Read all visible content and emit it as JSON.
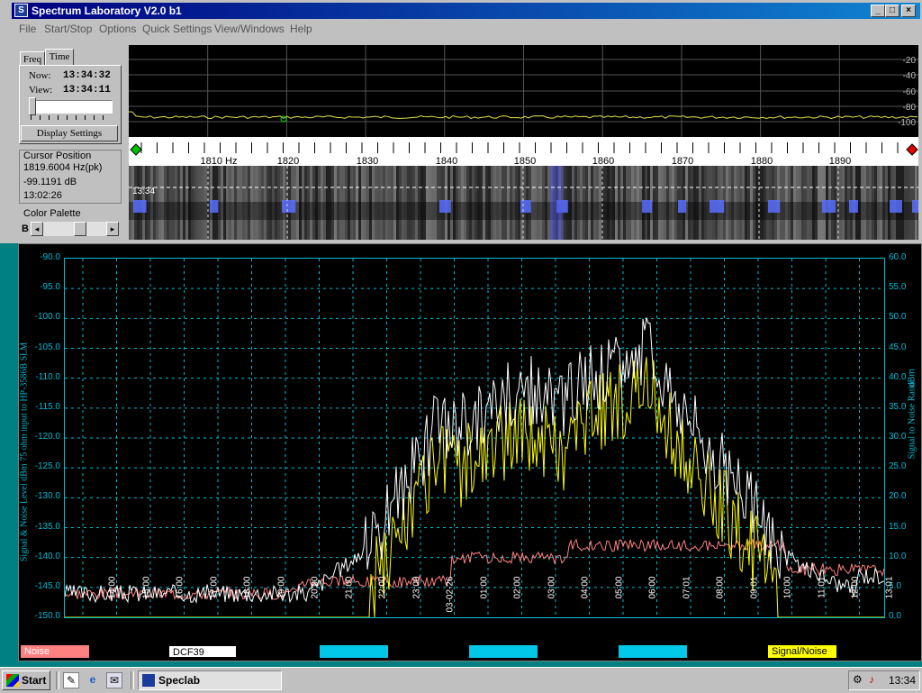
{
  "window": {
    "title": "Spectrum Laboratory V2.0 b1",
    "minimize": "_",
    "maximize": "□",
    "close": "×"
  },
  "menu": {
    "file": "File",
    "start_stop": "Start/Stop",
    "options": "Options",
    "quick_settings": "Quick Settings",
    "view_windows": "View/Windows",
    "help": "Help"
  },
  "left_panel": {
    "tab_freq": "Freq",
    "tab_time": "Time",
    "now_label": "Now:",
    "now_value": "13:34:32",
    "view_label": "View:",
    "view_value": "13:34:11",
    "display_settings": "Display Settings",
    "cursor_title": "Cursor Position",
    "cursor_freq": "1819.6004 Hz(pk)",
    "cursor_db": "-99.1191 dB",
    "cursor_time": "13:02:26",
    "palette_title": "Color Palette",
    "palette_b": "B"
  },
  "spectrum": {
    "db_labels": [
      "-20",
      "-40",
      "-60",
      "-80",
      "-100"
    ],
    "freq_ticks": [
      "1810 Hz",
      "1820",
      "1830",
      "1840",
      "1850",
      "1860",
      "1870",
      "1880",
      "1890"
    ],
    "waterfall_time": "13:34"
  },
  "plot": {
    "left_axis_title": "Signal & Noise Level  dBm 75 ohm input to HP-3586B SLM",
    "right_axis_title_a": "Signal to Noise Ratio",
    "right_axis_title_b": "dBm",
    "left_ticks": [
      "-90.0",
      "-95.0",
      "-100.0",
      "-105.0",
      "-110.0",
      "-115.0",
      "-120.0",
      "-125.0",
      "-130.0",
      "-135.0",
      "-140.0",
      "-145.0",
      "-150.0"
    ],
    "right_ticks": [
      "60.0",
      "55.0",
      "50.0",
      "45.0",
      "40.0",
      "35.0",
      "30.0",
      "25.0",
      "20.0",
      "15.0",
      "10.0",
      "5.0",
      "0.0"
    ],
    "time_labels": [
      "14:00",
      "15:00",
      "16:00",
      "17:00",
      "18:00",
      "19:00",
      "20:00",
      "21:00",
      "22:00",
      "23:00",
      "03-02-26",
      "01:00",
      "02:00",
      "03:00",
      "04:00",
      "05:00",
      "06:00",
      "07:01",
      "08:00",
      "09:01",
      "10:00",
      "11:01",
      "12:00",
      "13:01"
    ],
    "legend": {
      "noise": "Noise",
      "dcf39": "DCF39",
      "snr": "Signal/Noise"
    },
    "colors": {
      "signal": "#ffffff",
      "snr": "#ffff00",
      "noise": "#ff8080",
      "grid": "#00bcd4",
      "legend_blue": "#00c8e6"
    }
  },
  "taskbar": {
    "start": "Start",
    "app": "Speclab",
    "clock": "13:34"
  }
}
